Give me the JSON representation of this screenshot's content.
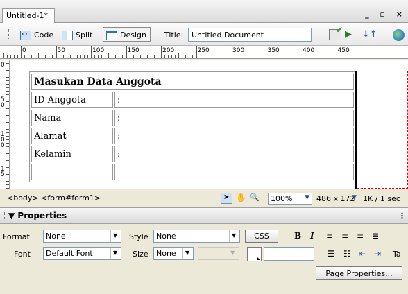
{
  "tab": {
    "title": "Untitled-1*",
    "window_controls": "_ ▫ ×"
  },
  "toolbar": {
    "code_label": "Code",
    "split_label": "Split",
    "design_label": "Design",
    "title_label": "Title:",
    "title_value": "Untitled Document",
    "active_view": "Design"
  },
  "ruler": {
    "h_labels": [
      "0",
      "50",
      "100",
      "150",
      "200",
      "250",
      "300",
      "350",
      "400",
      "450"
    ],
    "v_labels": [
      "0",
      "5\n0",
      "1\n0\n0",
      "1\n5"
    ]
  },
  "form_table": {
    "title": "Masukan Data Anggota",
    "rows": [
      {
        "label": "ID Anggota",
        "value": ":"
      },
      {
        "label": "Nama",
        "value": ":"
      },
      {
        "label": "Alamat",
        "value": ":"
      },
      {
        "label": "Kelamin",
        "value": ":"
      },
      {
        "label": "",
        "value": ""
      }
    ]
  },
  "statusbar": {
    "tag_selector": "<body> <form#form1>",
    "zoom": "100%",
    "window_size": "486 x 172",
    "download": "1K / 1 sec"
  },
  "properties": {
    "title": "Properties",
    "format_label": "Format",
    "format_value": "None",
    "style_label": "Style",
    "style_value": "None",
    "css_label": "CSS",
    "font_label": "Font",
    "font_value": "Default Font",
    "size_label": "Size",
    "size_value": "None",
    "bold_label": "B",
    "italic_label": "I",
    "truncated_label": "Ta",
    "page_properties_label": "Page Properties..."
  }
}
